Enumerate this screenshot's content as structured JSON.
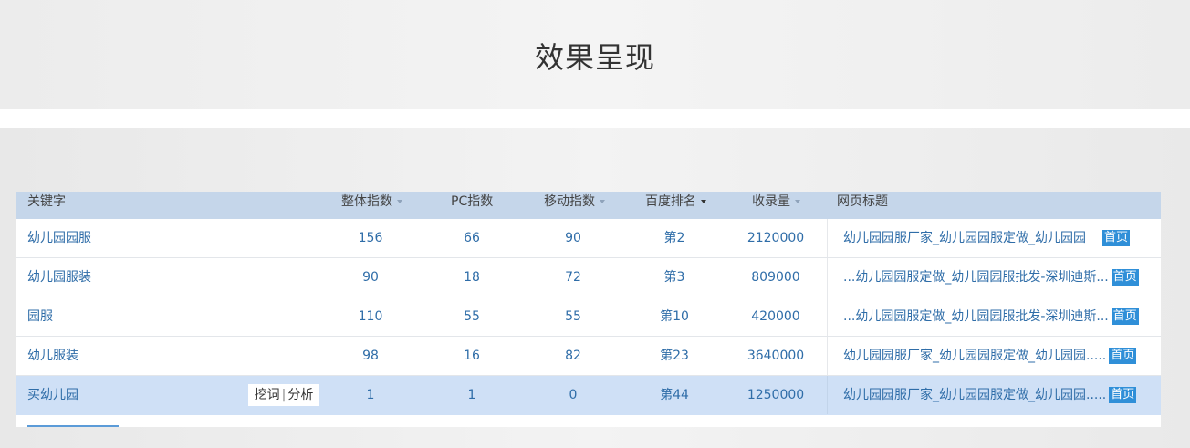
{
  "page": {
    "title": "效果呈现"
  },
  "table": {
    "headers": {
      "keyword": "关键字",
      "overall_index": "整体指数",
      "pc_index": "PC指数",
      "mobile_index": "移动指数",
      "baidu_rank": "百度排名",
      "indexed_count": "收录量",
      "page_title": "网页标题"
    },
    "homepage_label": "首页",
    "actions": {
      "dig": "挖词",
      "separator": "|",
      "analyze": "分析"
    },
    "rows": [
      {
        "keyword": "幼儿园园服",
        "overall": "156",
        "pc": "66",
        "mobile": "90",
        "rank": "第2",
        "indexed": "2120000",
        "title": "幼儿园园服厂家_幼儿园园服定做_幼儿园园"
      },
      {
        "keyword": "幼儿园服装",
        "overall": "90",
        "pc": "18",
        "mobile": "72",
        "rank": "第3",
        "indexed": "809000",
        "title": "...幼儿园园服定做_幼儿园园服批发-深圳迪斯..."
      },
      {
        "keyword": "园服",
        "overall": "110",
        "pc": "55",
        "mobile": "55",
        "rank": "第10",
        "indexed": "420000",
        "title": "...幼儿园园服定做_幼儿园园服批发-深圳迪斯..."
      },
      {
        "keyword": "幼儿服装",
        "overall": "98",
        "pc": "16",
        "mobile": "82",
        "rank": "第23",
        "indexed": "3640000",
        "title": "幼儿园园服厂家_幼儿园园服定做_幼儿园园....."
      },
      {
        "keyword": "买幼儿园",
        "overall": "1",
        "pc": "1",
        "mobile": "0",
        "rank": "第44",
        "indexed": "1250000",
        "title": "幼儿园园服厂家_幼儿园园服定做_幼儿园园....."
      }
    ]
  },
  "colors": {
    "header_bg": "#c5d6ea",
    "link": "#2f6da8",
    "selected_row": "#cfe0f6",
    "badge": "#2f8fd8"
  }
}
